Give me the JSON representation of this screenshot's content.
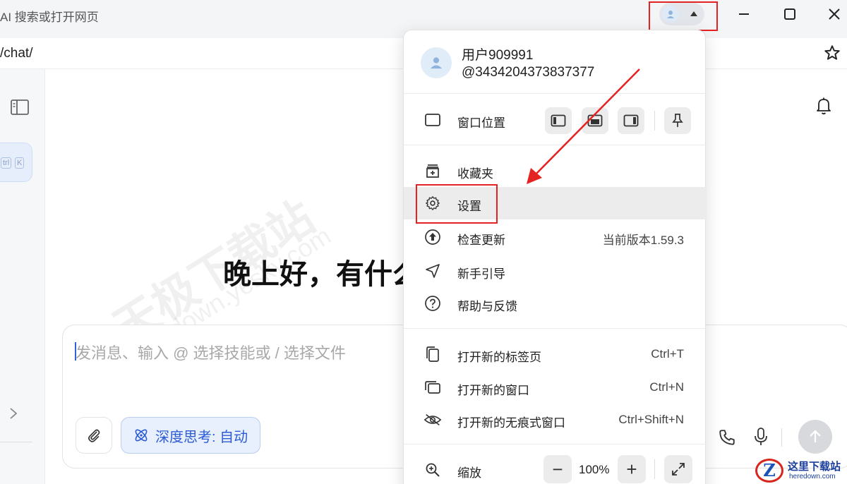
{
  "titlebar": {
    "search_placeholder": "AI 搜索或打开网页"
  },
  "addressbar": {
    "url": "/chat/"
  },
  "sidebar": {
    "shortcut_keys": [
      "trl",
      "K"
    ]
  },
  "main": {
    "greeting": "晚上好，有什么",
    "composer_placeholder": "发消息、输入 @ 选择技能或 / 选择文件",
    "deep_think_label": "深度思考: 自动"
  },
  "watermark": {
    "line1": "天极下载站",
    "line2": "mydown.yesky.com"
  },
  "menu": {
    "user_name": "用户909991",
    "user_id": "@3434204373837377",
    "window_position": "窗口位置",
    "favorites": "收藏夹",
    "settings": "设置",
    "check_update": "检查更新",
    "current_version": "当前版本1.59.3",
    "beginner_guide": "新手引导",
    "help_feedback": "帮助与反馈",
    "new_tab": "打开新的标签页",
    "new_tab_shortcut": "Ctrl+T",
    "new_window": "打开新的窗口",
    "new_window_shortcut": "Ctrl+N",
    "new_incognito": "打开新的无痕式窗口",
    "new_incognito_shortcut": "Ctrl+Shift+N",
    "zoom": "缩放",
    "zoom_value": "100%",
    "zoom_minus": "−",
    "zoom_plus": "+"
  },
  "logo": {
    "z": "Z",
    "title": "这里下载站",
    "domain": "heredown.com"
  },
  "colors": {
    "annotation_red": "#e52222",
    "accent_blue": "#2d5bd3"
  }
}
